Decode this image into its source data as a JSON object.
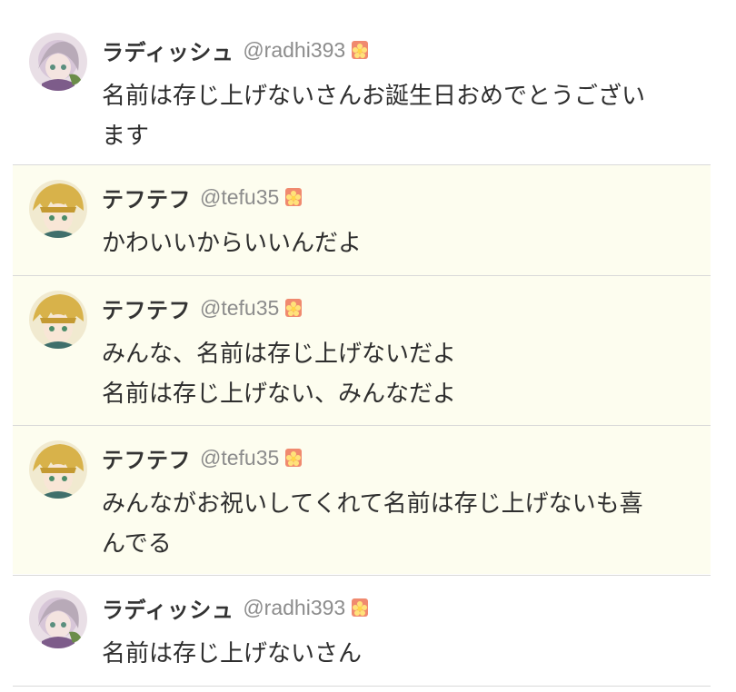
{
  "posts": [
    {
      "display_name": "ラディッシュ",
      "handle": "@radhi393",
      "avatar": "radish-avatar",
      "badge": "flower-badge-icon",
      "text": "名前は存じ上げないさんお誕生日おめでとうござい\nます"
    },
    {
      "display_name": "テフテフ",
      "handle": "@tefu35",
      "avatar": "tefu-avatar",
      "badge": "flower-badge-icon",
      "text": "かわいいからいいんだよ"
    },
    {
      "display_name": "テフテフ",
      "handle": "@tefu35",
      "avatar": "tefu-avatar",
      "badge": "flower-badge-icon",
      "text": "みんな、名前は存じ上げないだよ\n名前は存じ上げない、みんなだよ"
    },
    {
      "display_name": "テフテフ",
      "handle": "@tefu35",
      "avatar": "tefu-avatar",
      "badge": "flower-badge-icon",
      "text": "みんながお祝いしてくれて名前は存じ上げないも喜\nんでる"
    },
    {
      "display_name": "ラディッシュ",
      "handle": "@radhi393",
      "avatar": "radish-avatar",
      "badge": "flower-badge-icon",
      "text": "名前は存じ上げないさん"
    }
  ],
  "colors": {
    "thread_background": "#fdfdef",
    "handle_gray": "#8c8c8c",
    "divider": "#d9d9d9"
  }
}
